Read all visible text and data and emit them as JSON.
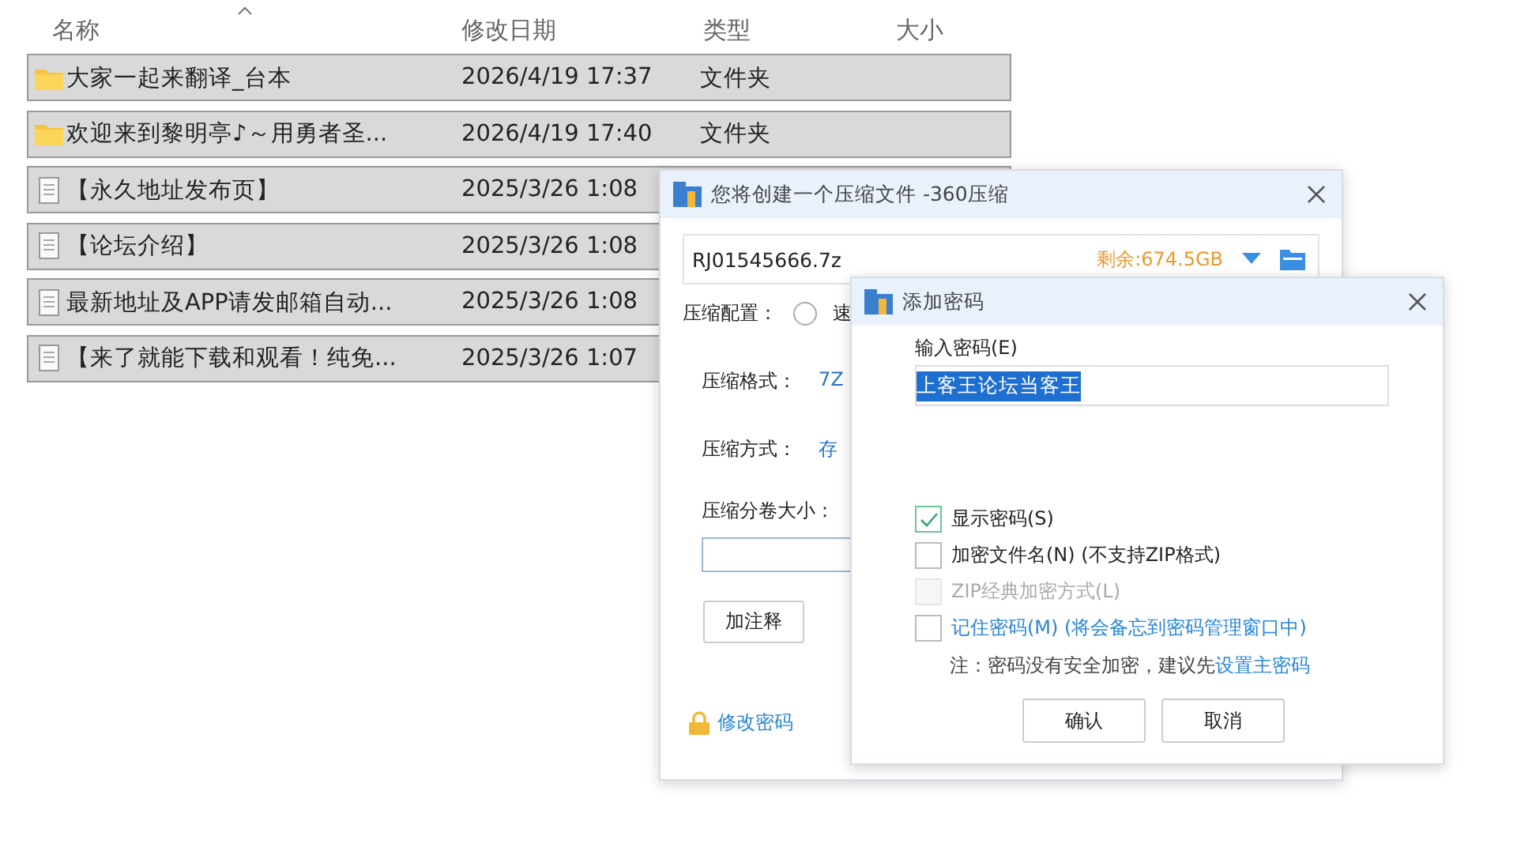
{
  "file_list": {
    "columns": [
      "名称",
      "修改日期",
      "类型",
      "大小"
    ],
    "rows": [
      {
        "kind": "folder",
        "name": "大家一起来翻译_台本",
        "modified": "2026/4/19 17:37",
        "type": "文件夹",
        "selected": true
      },
      {
        "kind": "folder",
        "name": "欢迎来到黎明亭♪～用勇者圣...",
        "modified": "2026/4/19 17:40",
        "type": "文件夹",
        "selected": true
      },
      {
        "kind": "file",
        "name": "【永久地址发布页】",
        "modified": "2025/3/26 1:08",
        "selected": true
      },
      {
        "kind": "file",
        "name": "【论坛介绍】",
        "modified": "2025/3/26 1:08",
        "selected": true
      },
      {
        "kind": "file",
        "name": "最新地址及APP请发邮箱自动...",
        "modified": "2025/3/26 1:08",
        "selected": true
      },
      {
        "kind": "file",
        "name": "【来了就能下载和观看！纯免...",
        "modified": "2025/3/26 1:07",
        "selected": true
      }
    ]
  },
  "compress_dialog": {
    "title": "您将创建一个压缩文件 -360压缩",
    "archive_name": "RJ01545666.7z",
    "free_space": "剩余:674.5GB",
    "config_label": "压缩配置：",
    "config_option": {
      "label": "速",
      "selected": false
    },
    "format_label": "压缩格式：",
    "format_value": "7Z",
    "method_label": "压缩方式：",
    "method_value": "存",
    "split_label": "压缩分卷大小：",
    "comment_button": "加注释",
    "change_password_link": "修改密码"
  },
  "password_dialog": {
    "title": "添加密码",
    "password_label": "输入密码(E)",
    "password_value": "上客王论坛当客王",
    "options": [
      {
        "kind": "plain",
        "label": "显示密码(S)",
        "checked": true,
        "disabled": false
      },
      {
        "kind": "plain",
        "label": "加密文件名(N) (不支持ZIP格式)",
        "checked": false,
        "disabled": false
      },
      {
        "kind": "plain",
        "label": "ZIP经典加密方式(L)",
        "checked": false,
        "disabled": true
      },
      {
        "kind": "link",
        "label": "记住密码(M) (将会备忘到密码管理窗口中)",
        "checked": false,
        "disabled": false
      }
    ],
    "note": "注：密码没有安全加密，建议先",
    "note_link": "设置主密码",
    "buttons": [
      "确认",
      "取消"
    ]
  }
}
